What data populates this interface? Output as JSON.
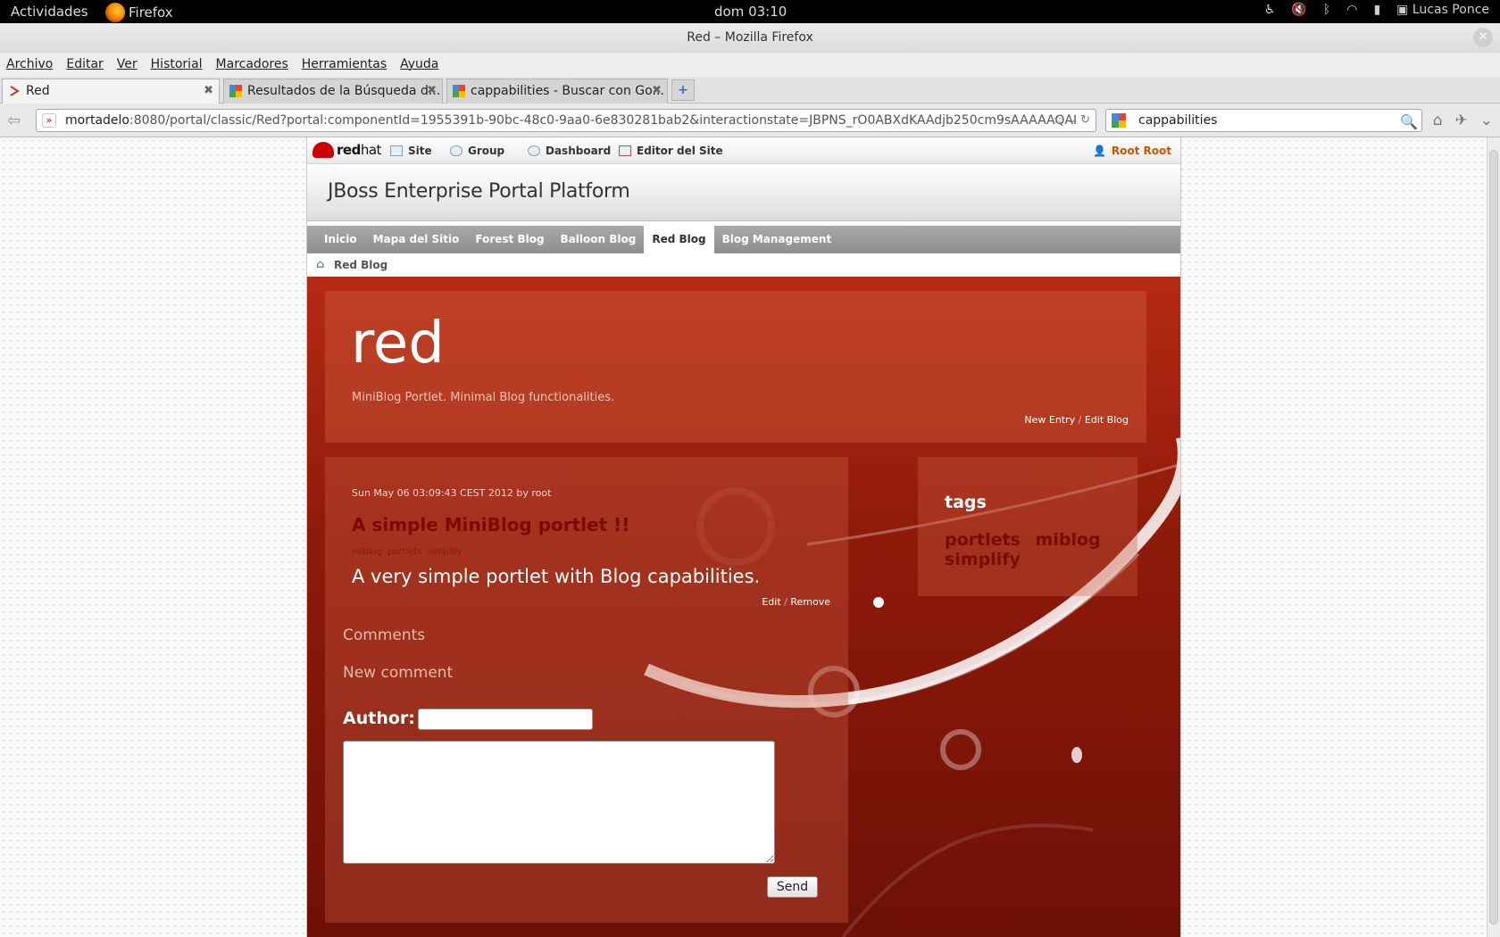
{
  "system_bar": {
    "activities": "Actividades",
    "app_name": "Firefox",
    "clock": "dom 03:10",
    "user": "Lucas Ponce"
  },
  "window": {
    "title": "Red – Mozilla Firefox",
    "close": "✕"
  },
  "menu": [
    "Archivo",
    "Editar",
    "Ver",
    "Historial",
    "Marcadores",
    "Herramientas",
    "Ayuda"
  ],
  "tabs": [
    {
      "label": "Red",
      "active": true
    },
    {
      "label": "Resultados de la Búsqueda d...",
      "active": false
    },
    {
      "label": "cappabilities - Buscar con Go...",
      "active": false
    }
  ],
  "newtab": "+",
  "url": {
    "host": "mortadelo",
    "rest": ":8080/portal/classic/Red?portal:componentId=1955391b-90bc-48c0-9aa0-6e830281bab2&interactionstate=JBPNS_rO0ABXdKAAdjb250cm9sAAAAAQAI"
  },
  "search": {
    "value": "cappabilities"
  },
  "portal": {
    "toolbar": {
      "logo_text_bold": "red",
      "logo_text": "hat",
      "site": "Site",
      "group": "Group",
      "dashboard": "Dashboard",
      "editor": "Editor del Site",
      "user": "Root Root"
    },
    "banner_title": "JBoss Enterprise Portal Platform",
    "nav": [
      "Inicio",
      "Mapa del Sitio",
      "Forest Blog",
      "Balloon Blog",
      "Red Blog",
      "Blog Management"
    ],
    "nav_selected": "Red Blog",
    "breadcrumb": "Red Blog"
  },
  "blog": {
    "name": "red",
    "description": "MiniBlog Portlet. Minimal Blog functionalities.",
    "new_entry": "New Entry",
    "separator": "/",
    "edit_blog": "Edit Blog"
  },
  "post": {
    "meta": "Sun May 06 03:09:43 CEST 2012 by root",
    "title": "A simple MiniBlog portlet !!",
    "tags": [
      "miblog",
      "portlets",
      "simplify"
    ],
    "body": "A very simple portlet with Blog capabilities.",
    "edit": "Edit",
    "remove": "Remove"
  },
  "comments": {
    "heading": "Comments",
    "new_heading": "New comment",
    "author_label": "Author:",
    "send": "Send"
  },
  "tags_panel": {
    "heading": "tags",
    "tags": [
      "portlets",
      "miblog",
      "simplify"
    ]
  }
}
